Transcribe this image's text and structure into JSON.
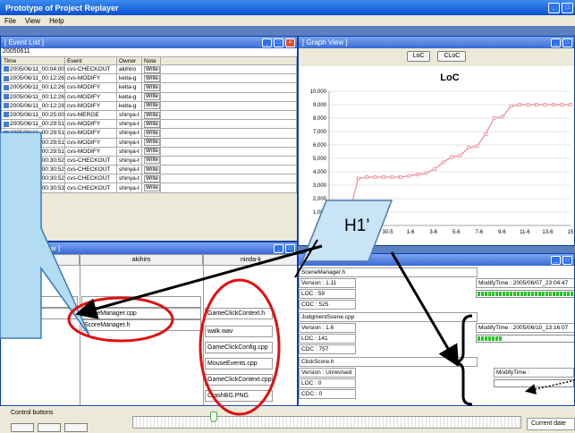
{
  "window": {
    "title": "Prototype of Project Replayer",
    "menu": [
      "File",
      "View",
      "Help"
    ]
  },
  "event_list": {
    "title": "[ Event List ]",
    "date": "20050611",
    "columns": [
      "Time",
      "Event",
      "Owner",
      "Note"
    ],
    "write_label": "Write",
    "rows": [
      {
        "time": "2005/06/11_00:04:00",
        "event": "cvs-CHECKOUT",
        "owner": "akihiro"
      },
      {
        "time": "2005/06/11_00:12:26",
        "event": "cvs-MODIFY",
        "owner": "keita-g"
      },
      {
        "time": "2005/06/11_00:12:26",
        "event": "cvs-MODIFY",
        "owner": "keita-g"
      },
      {
        "time": "2005/06/11_00:12:26",
        "event": "cvs-MODIFY",
        "owner": "keita-g"
      },
      {
        "time": "2005/06/11_00:12:28",
        "event": "cvs-MODIFY",
        "owner": "keita-g"
      },
      {
        "time": "2005/06/11_00:25:00",
        "event": "cvs-MERGE",
        "owner": "shinya-t"
      },
      {
        "time": "2005/06/11_00:29:51",
        "event": "cvs-MODIFY",
        "owner": "shinya-t"
      },
      {
        "time": "2005/06/11_00:29:51",
        "event": "cvs-MODIFY",
        "owner": "shinya-t"
      },
      {
        "time": "2005/06/11_00:29:51",
        "event": "cvs-MODIFY",
        "owner": "shinya-t"
      },
      {
        "time": "2005/06/11_00:29:51",
        "event": "cvs-MODIFY",
        "owner": "shinya-t"
      },
      {
        "time": "2005/06/11_00:30:52",
        "event": "cvs-CHECKOUT",
        "owner": "shinya-t"
      },
      {
        "time": "2005/06/11_00:30:52",
        "event": "cvs-CHECKOUT",
        "owner": "shinya-t"
      },
      {
        "time": "2005/06/11_00:30:52",
        "event": "cvs-CHECKOUT",
        "owner": "shinya-t"
      },
      {
        "time": "2005/06/11_00:30:53",
        "event": "cvs-CHECKOUT",
        "owner": "shinya-t"
      }
    ]
  },
  "graph_view": {
    "title": "[ Graph View ]",
    "buttons": [
      "LoC",
      "CLoC"
    ]
  },
  "chart_data": {
    "type": "line",
    "title": "LoC",
    "ylim": [
      0,
      10000
    ],
    "yticks": [
      "1,000",
      "2,000",
      "3,000",
      "4,000",
      "5,000",
      "6,000",
      "7,000",
      "8,000",
      "9,000",
      "10,000"
    ],
    "xticks": [
      "5-6",
      "30-5",
      "1-6",
      "3-6",
      "5-6",
      "7-6",
      "9-6",
      "11-6",
      "13-6",
      "15"
    ],
    "series": [
      {
        "x": [
          1,
          2,
          3,
          4,
          5,
          6,
          7,
          8,
          9,
          10,
          11,
          12,
          13,
          14,
          15,
          16,
          17,
          18,
          19,
          20,
          21,
          22,
          23,
          24,
          25,
          26,
          27,
          28,
          29
        ],
        "values": [
          1000,
          1000,
          1000,
          3500,
          3600,
          3600,
          3600,
          3600,
          3600,
          3700,
          3800,
          3900,
          4200,
          4700,
          5100,
          5200,
          5800,
          5900,
          6800,
          8000,
          8100,
          8900,
          9000,
          9000,
          9000,
          9000,
          9000,
          9000,
          9000
        ]
      }
    ]
  },
  "member_view": {
    "title": "[ Memberp View ]",
    "columns": [
      "",
      "akihiro",
      "ninda-k"
    ],
    "col2_items": [
      "ScoreManager.cpp",
      "ScoreManager.h"
    ],
    "col3_items": [
      "GameClickContext.h",
      "walk.wav",
      "GameClickConfig.cpp",
      "MouseEvents.cpp",
      "GameClickContext.cpp",
      "CrashBG.PNG"
    ]
  },
  "file_view": {
    "files": [
      {
        "name": "SceneManager.h",
        "version": "Version :  1.11",
        "loc": "LOC : 59",
        "cdc": "CDC : 525",
        "modify": "ModifyTime : 2005/06/07_23:04:47",
        "progress": 1.0
      },
      {
        "name": "JudgmentScene.cpp",
        "version": "Version :  1.6",
        "loc": "LOC : 141",
        "cdc": "CDC : 757",
        "modify": "ModifyTime : 2005/06/10_13:16:07",
        "progress": 0.25
      },
      {
        "name": "ClickScore.h",
        "version": "Version : Unrevised",
        "loc": "LOC : 0",
        "cdc": "CDC : 0",
        "modify": "ModifyTime :",
        "progress": 0
      }
    ]
  },
  "controls": {
    "label": "Control buttons",
    "current_date_label": "Current date"
  },
  "annotation": {
    "h1_label": "H1’"
  },
  "colors": {
    "title_blue": "#0b4fd4",
    "line_pink": "#e98a96",
    "ellipse_red": "#e01010",
    "callout_fill": "#b3dcf2",
    "progress_green": "#27c227"
  }
}
